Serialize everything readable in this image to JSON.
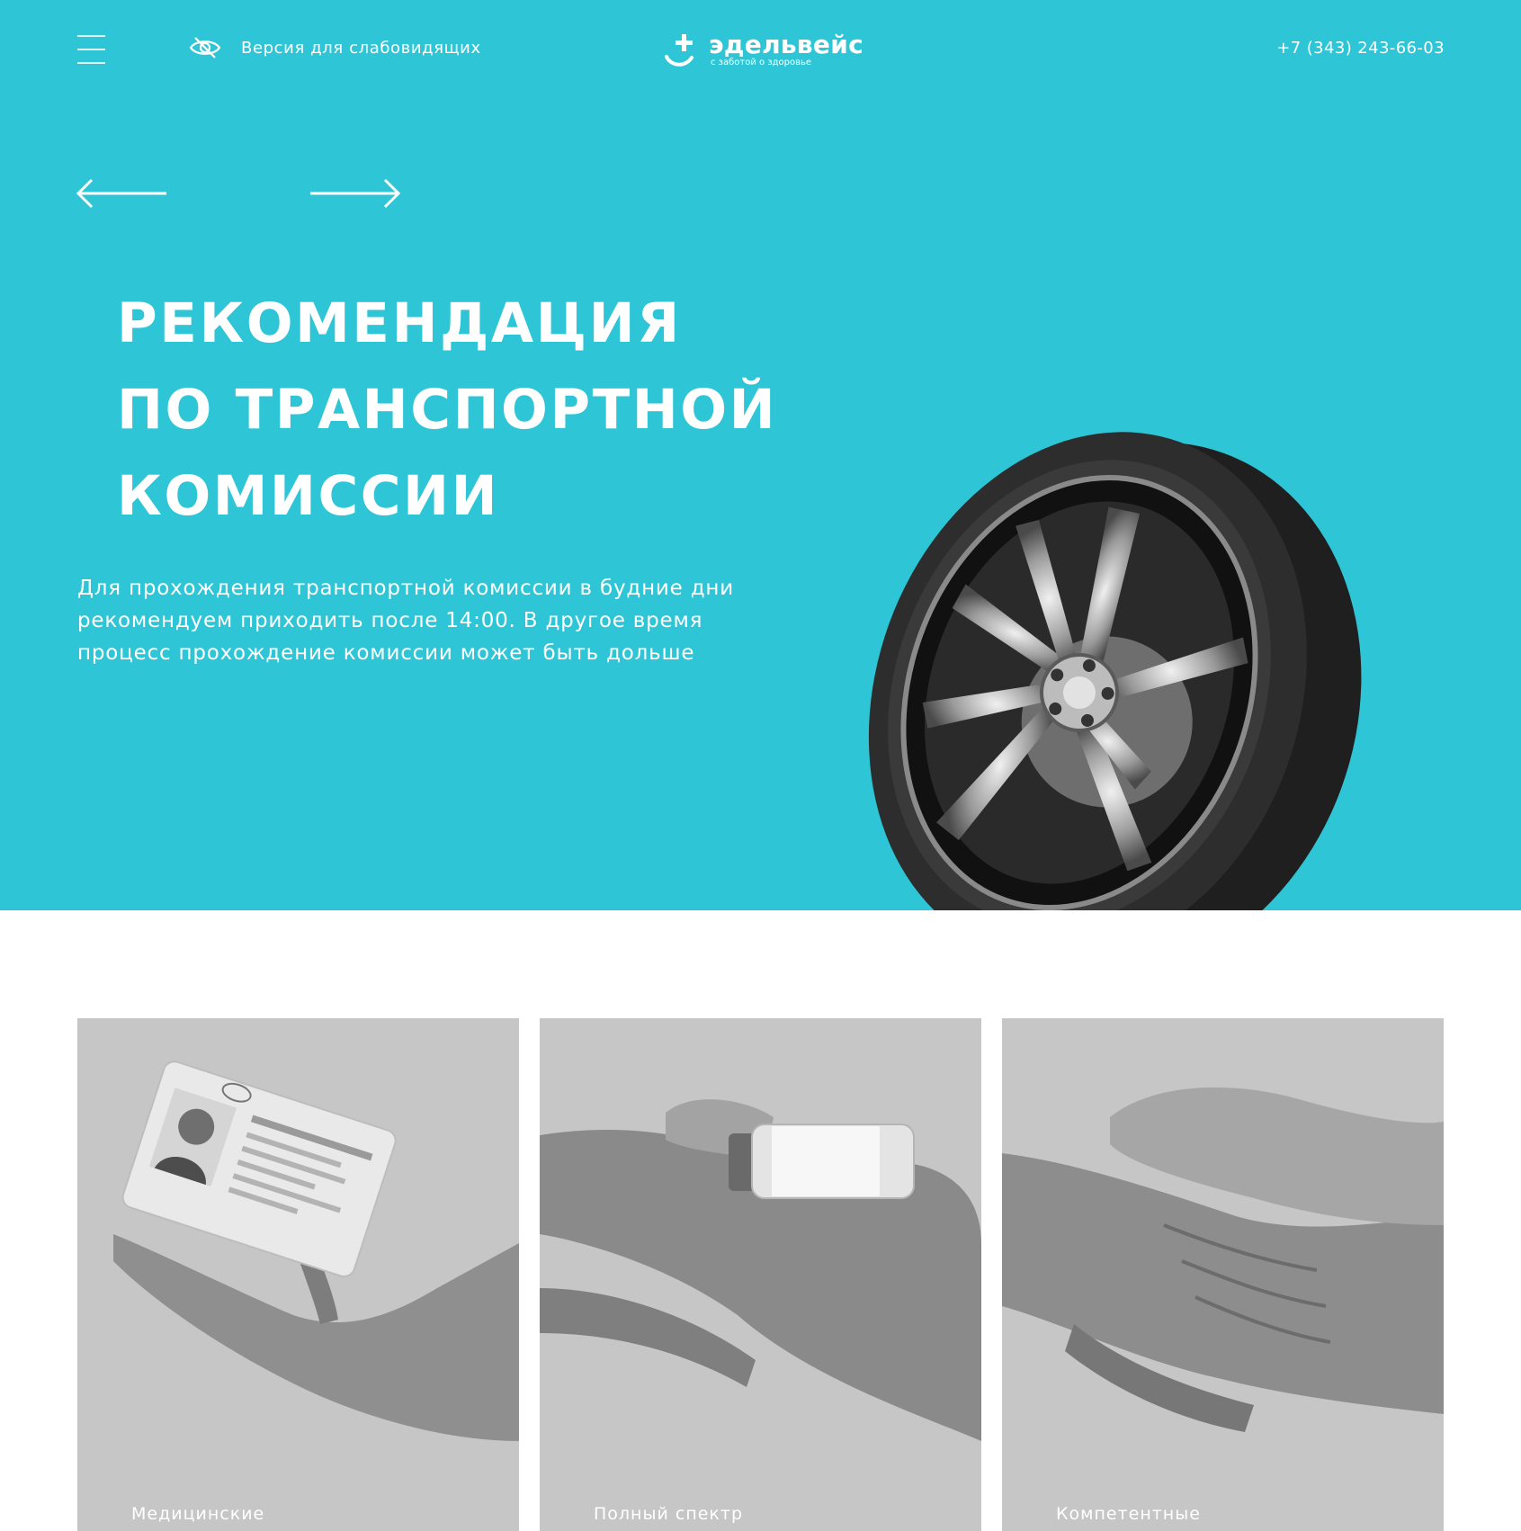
{
  "header": {
    "menu_icon": "hamburger-menu-icon",
    "accessibility_icon": "eye-crossed-icon",
    "accessibility_label": "Версия для слабовидящих",
    "logo": {
      "name": "эдельвейс",
      "tagline": "с заботой о здоровье"
    },
    "phone": "+7 (343) 243-66-03"
  },
  "slider": {
    "prev_icon": "arrow-left-icon",
    "next_icon": "arrow-right-icon"
  },
  "hero": {
    "title_lines": [
      "РЕКОМЕНДАЦИЯ",
      "ПО ТРАНСПОРТНОЙ",
      "КОМИССИИ"
    ],
    "description_lines": [
      "Для прохождения транспортной комиссии в будние дни",
      "рекомендуем приходить после 14:00. В другое время",
      "процесс прохождение комиссии может быть дольше"
    ]
  },
  "cards": [
    {
      "caption": "Медицинские"
    },
    {
      "caption": "Полный спектр"
    },
    {
      "caption": "Компетентные"
    }
  ],
  "colors": {
    "hero_bg": "#2ec6d6",
    "card_bg": "#c6c6c6",
    "text_light": "#ffffff"
  }
}
